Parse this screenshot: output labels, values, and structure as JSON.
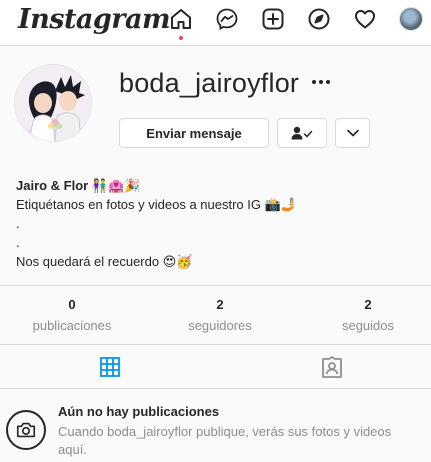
{
  "nav": {
    "logo": "Instagram",
    "icons": [
      "home-icon",
      "messenger-icon",
      "new-post-icon",
      "explore-icon",
      "activity-heart-icon",
      "profile-avatar"
    ],
    "notification_color": "#ed4956"
  },
  "profile": {
    "username": "boda_jairoyflor",
    "more_label": "...",
    "message_button": "Enviar mensaje",
    "follow_icon": "person-check-icon",
    "dropdown_icon": "chevron-down-icon"
  },
  "bio": {
    "name": "Jairo & Flor 👫🏩🎉",
    "line1": "Etiquétanos en fotos y videos a nuestro IG 📸🤳",
    "line2": ".",
    "line3": ".",
    "line4": "Nos quedará el recuerdo 😍🥳"
  },
  "stats": [
    {
      "value": "0",
      "label": "publicaciones"
    },
    {
      "value": "2",
      "label": "seguidores"
    },
    {
      "value": "2",
      "label": "seguidos"
    }
  ],
  "tabs": {
    "posts_icon": "grid-icon",
    "tagged_icon": "tagged-icon",
    "active_color": "#0095f6"
  },
  "empty_state": {
    "title": "Aún no hay publicaciones",
    "description": "Cuando boda_jairoyflor publique, verás sus fotos y videos aquí."
  }
}
